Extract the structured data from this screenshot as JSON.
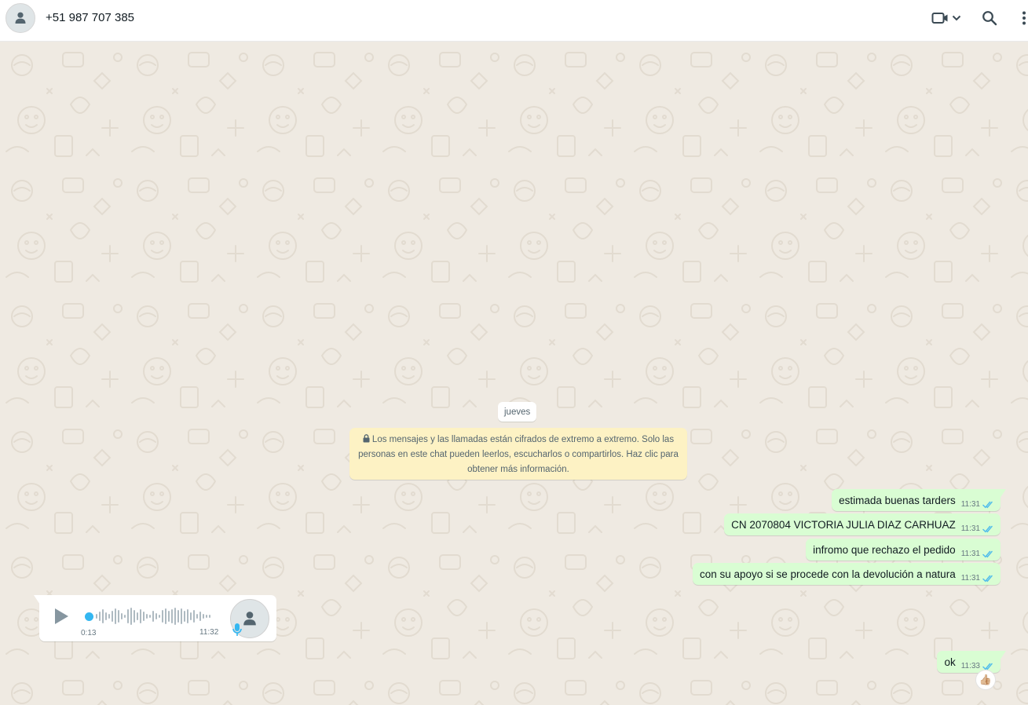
{
  "header": {
    "contact_name": "+51 987 707 385"
  },
  "chat": {
    "date_label": "jueves",
    "encryption_notice": "Los mensajes y las llamadas están cifrados de extremo a extremo. Solo las personas en este chat pueden leerlos, escucharlos o compartirlos. Haz clic para obtener más información.",
    "outgoing": [
      {
        "text": "estimada buenas tarders",
        "time": "11:31",
        "status": "read"
      },
      {
        "text": "CN 2070804 VICTORIA JULIA DIAZ CARHUAZ",
        "time": "11:31",
        "status": "read"
      },
      {
        "text": "infromo que rechazo el pedido",
        "time": "11:31",
        "status": "read"
      },
      {
        "text": "con su apoyo si se procede con la devolución a natura",
        "time": "11:31",
        "status": "read"
      },
      {
        "text": "ok",
        "time": "11:33",
        "status": "read"
      }
    ],
    "voice_note": {
      "duration": "0:13",
      "time": "11:32",
      "progress": 0
    },
    "reaction": "👍🏼"
  },
  "colors": {
    "outgoing_bubble": "#d9fdd3",
    "read_ticks": "#53bdeb",
    "wallpaper": "#efeae2",
    "notice": "#fdf2c4"
  }
}
